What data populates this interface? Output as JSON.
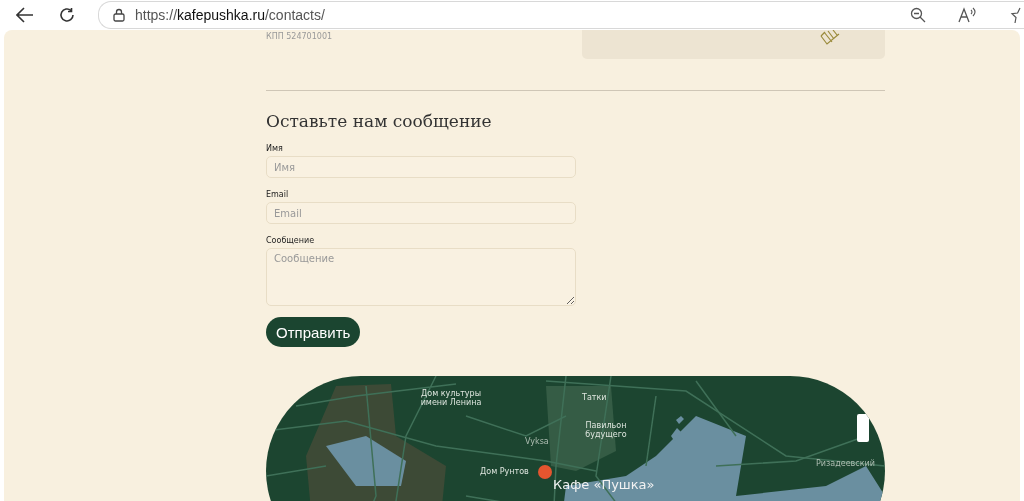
{
  "browser": {
    "url": "https://**kafepushka.ru**/contacts/"
  },
  "company_info": {
    "kpp": "КПП 524701001"
  },
  "form": {
    "title": "Оставьте нам сообщение",
    "fields": [
      {
        "kind": "input",
        "label": "Имя",
        "placeholder": "Имя"
      },
      {
        "kind": "input",
        "label": "Email",
        "placeholder": "Email"
      },
      {
        "kind": "textarea",
        "label": "Сообщение",
        "placeholder": "Сообщение"
      }
    ],
    "submit": "Отправить"
  },
  "map": {
    "labels": [
      {
        "kind": "poi",
        "text": "Дом культуры имени Ленина"
      },
      {
        "kind": "poi",
        "text": "Татки"
      },
      {
        "kind": "poi",
        "text": "Павильон будущего"
      },
      {
        "kind": "place",
        "text": "Vyksa"
      },
      {
        "kind": "poi",
        "text": "Дом Рунтов"
      },
      {
        "kind": "place",
        "text": "Ризадеевский"
      },
      {
        "kind": "marker",
        "text": "Кафе «Пушка»"
      }
    ]
  }
}
